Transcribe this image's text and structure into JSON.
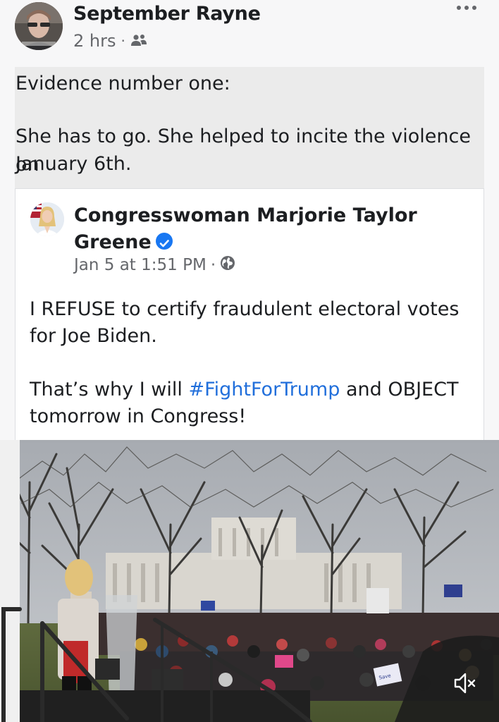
{
  "post": {
    "author": "September Rayne",
    "time": "2 hrs",
    "separator": "·",
    "audience_icon": "friends-icon",
    "more_icon": "more-dots-icon",
    "text_line1": "Evidence number one:",
    "text_line2": "She has to go. She helped to incite the violence on",
    "text_line3": "January 6th."
  },
  "shared_post": {
    "author": "Congresswoman Marjorie Taylor Greene",
    "verified_icon": "verified-badge-icon",
    "time": "Jan 5 at 1:51 PM",
    "separator": "·",
    "audience_icon": "globe-icon",
    "para1_line1": "I REFUSE to certify fraudulent electoral votes",
    "para1_line2": "for Joe Biden.",
    "para2_prefix": "That’s why I will ",
    "hashtag": "#FightForTrump",
    "para2_suffix": " and OBJECT",
    "para2_line2": "tomorrow in Congress!"
  },
  "video": {
    "mute_icon": "speaker-muted-icon",
    "sign_text": "Save the Republic"
  },
  "colors": {
    "accent": "#216fdb",
    "verified": "#1877f2",
    "secondary_text": "#65676b"
  }
}
